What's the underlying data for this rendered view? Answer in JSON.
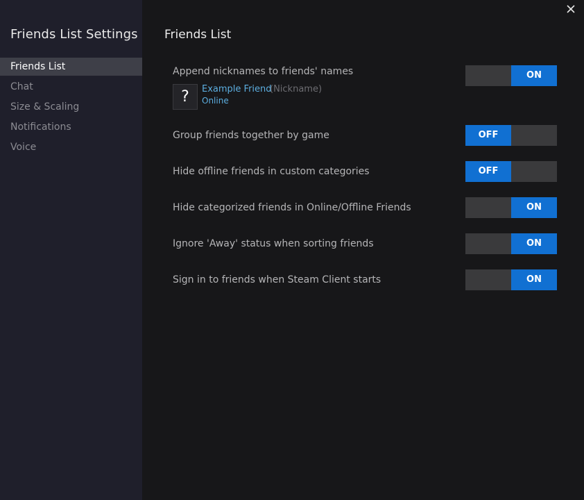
{
  "sidebar": {
    "title": "Friends List Settings",
    "items": [
      {
        "label": "Friends List"
      },
      {
        "label": "Chat"
      },
      {
        "label": "Size & Scaling"
      },
      {
        "label": "Notifications"
      },
      {
        "label": "Voice"
      }
    ],
    "active_index": 0
  },
  "window": {
    "close_icon": "close-icon"
  },
  "main": {
    "title": "Friends List",
    "preview": {
      "avatar_glyph": "?",
      "friend_name": "Example Friend",
      "nickname": "(Nickname)",
      "status": "Online"
    },
    "settings": [
      {
        "label": "Append nicknames to friends' names",
        "state": "on",
        "toggle_text": "ON"
      },
      {
        "label": "Group friends together by game",
        "state": "off",
        "toggle_text": "OFF"
      },
      {
        "label": "Hide offline friends in custom categories",
        "state": "off",
        "toggle_text": "OFF"
      },
      {
        "label": "Hide categorized friends in Online/Offline Friends",
        "state": "on",
        "toggle_text": "ON"
      },
      {
        "label": "Ignore 'Away' status when sorting friends",
        "state": "on",
        "toggle_text": "ON"
      },
      {
        "label": "Sign in to friends when Steam Client starts",
        "state": "on",
        "toggle_text": "ON"
      }
    ]
  },
  "colors": {
    "accent": "#1170d2",
    "link": "#5caee0",
    "sidebar_bg": "#1f1f2b",
    "main_bg": "#171719",
    "active_item_bg": "#3e3f48"
  }
}
